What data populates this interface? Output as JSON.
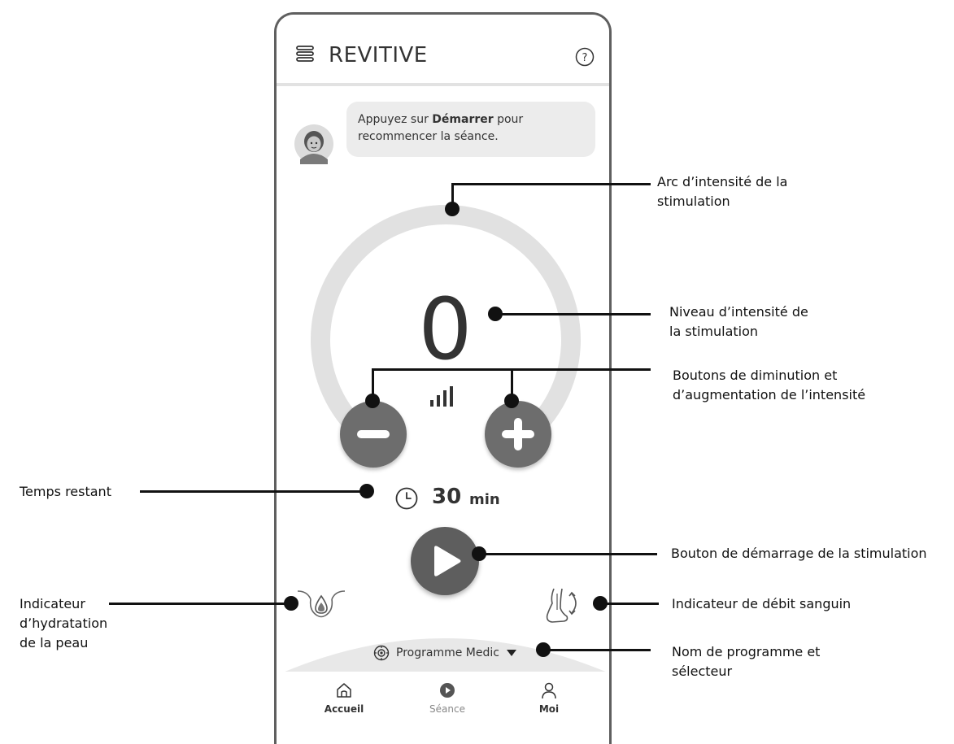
{
  "app": {
    "title": "REVITIVE",
    "menu_icon": "hamburger-menu-icon",
    "help_icon": "help-question-icon"
  },
  "coach": {
    "avatar": "coach-avatar",
    "message_prefix": "Appuyez sur ",
    "message_bold": "Démarrer",
    "message_suffix": " pour recommencer la séance."
  },
  "stimulation": {
    "intensity_level": "0",
    "intensity_arc_fill_fraction": 0,
    "signal_icon": "signal-bars-icon",
    "decrease_icon": "minus-icon",
    "increase_icon": "plus-icon"
  },
  "timer": {
    "value": "30",
    "unit": "min",
    "icon": "clock-icon"
  },
  "start": {
    "icon": "play-icon"
  },
  "indicators": {
    "skin_hydration_icon": "skin-hydration-icon",
    "blood_flow_icon": "blood-flow-icon"
  },
  "program": {
    "icon": "program-target-icon",
    "name": "Programme Medic",
    "dropdown_icon": "caret-down-icon"
  },
  "nav": {
    "items": [
      {
        "label": "Accueil",
        "icon": "home-icon"
      },
      {
        "label": "Séance",
        "icon": "play-circle-icon"
      },
      {
        "label": "Moi",
        "icon": "user-icon"
      }
    ]
  },
  "callouts": {
    "arc": "Arc d’intensité de la stimulation",
    "level": "Niveau d’intensité de la stimulation",
    "buttons": "Boutons de diminution et d’augmentation de l’intensité",
    "time": "Temps restant",
    "start": "Bouton de démarrage de la stimulation",
    "hydration": "Indicateur d’hydratation de la peau",
    "bloodflow": "Indicateur de débit sanguin",
    "program": "Nom de programme et sélecteur"
  },
  "colors": {
    "arc_track": "#e1e1e1",
    "button_fill": "#6d6d6d",
    "play_fill": "#5e5e5e",
    "program_bar": "#e8e8e8",
    "callout": "#111111"
  }
}
